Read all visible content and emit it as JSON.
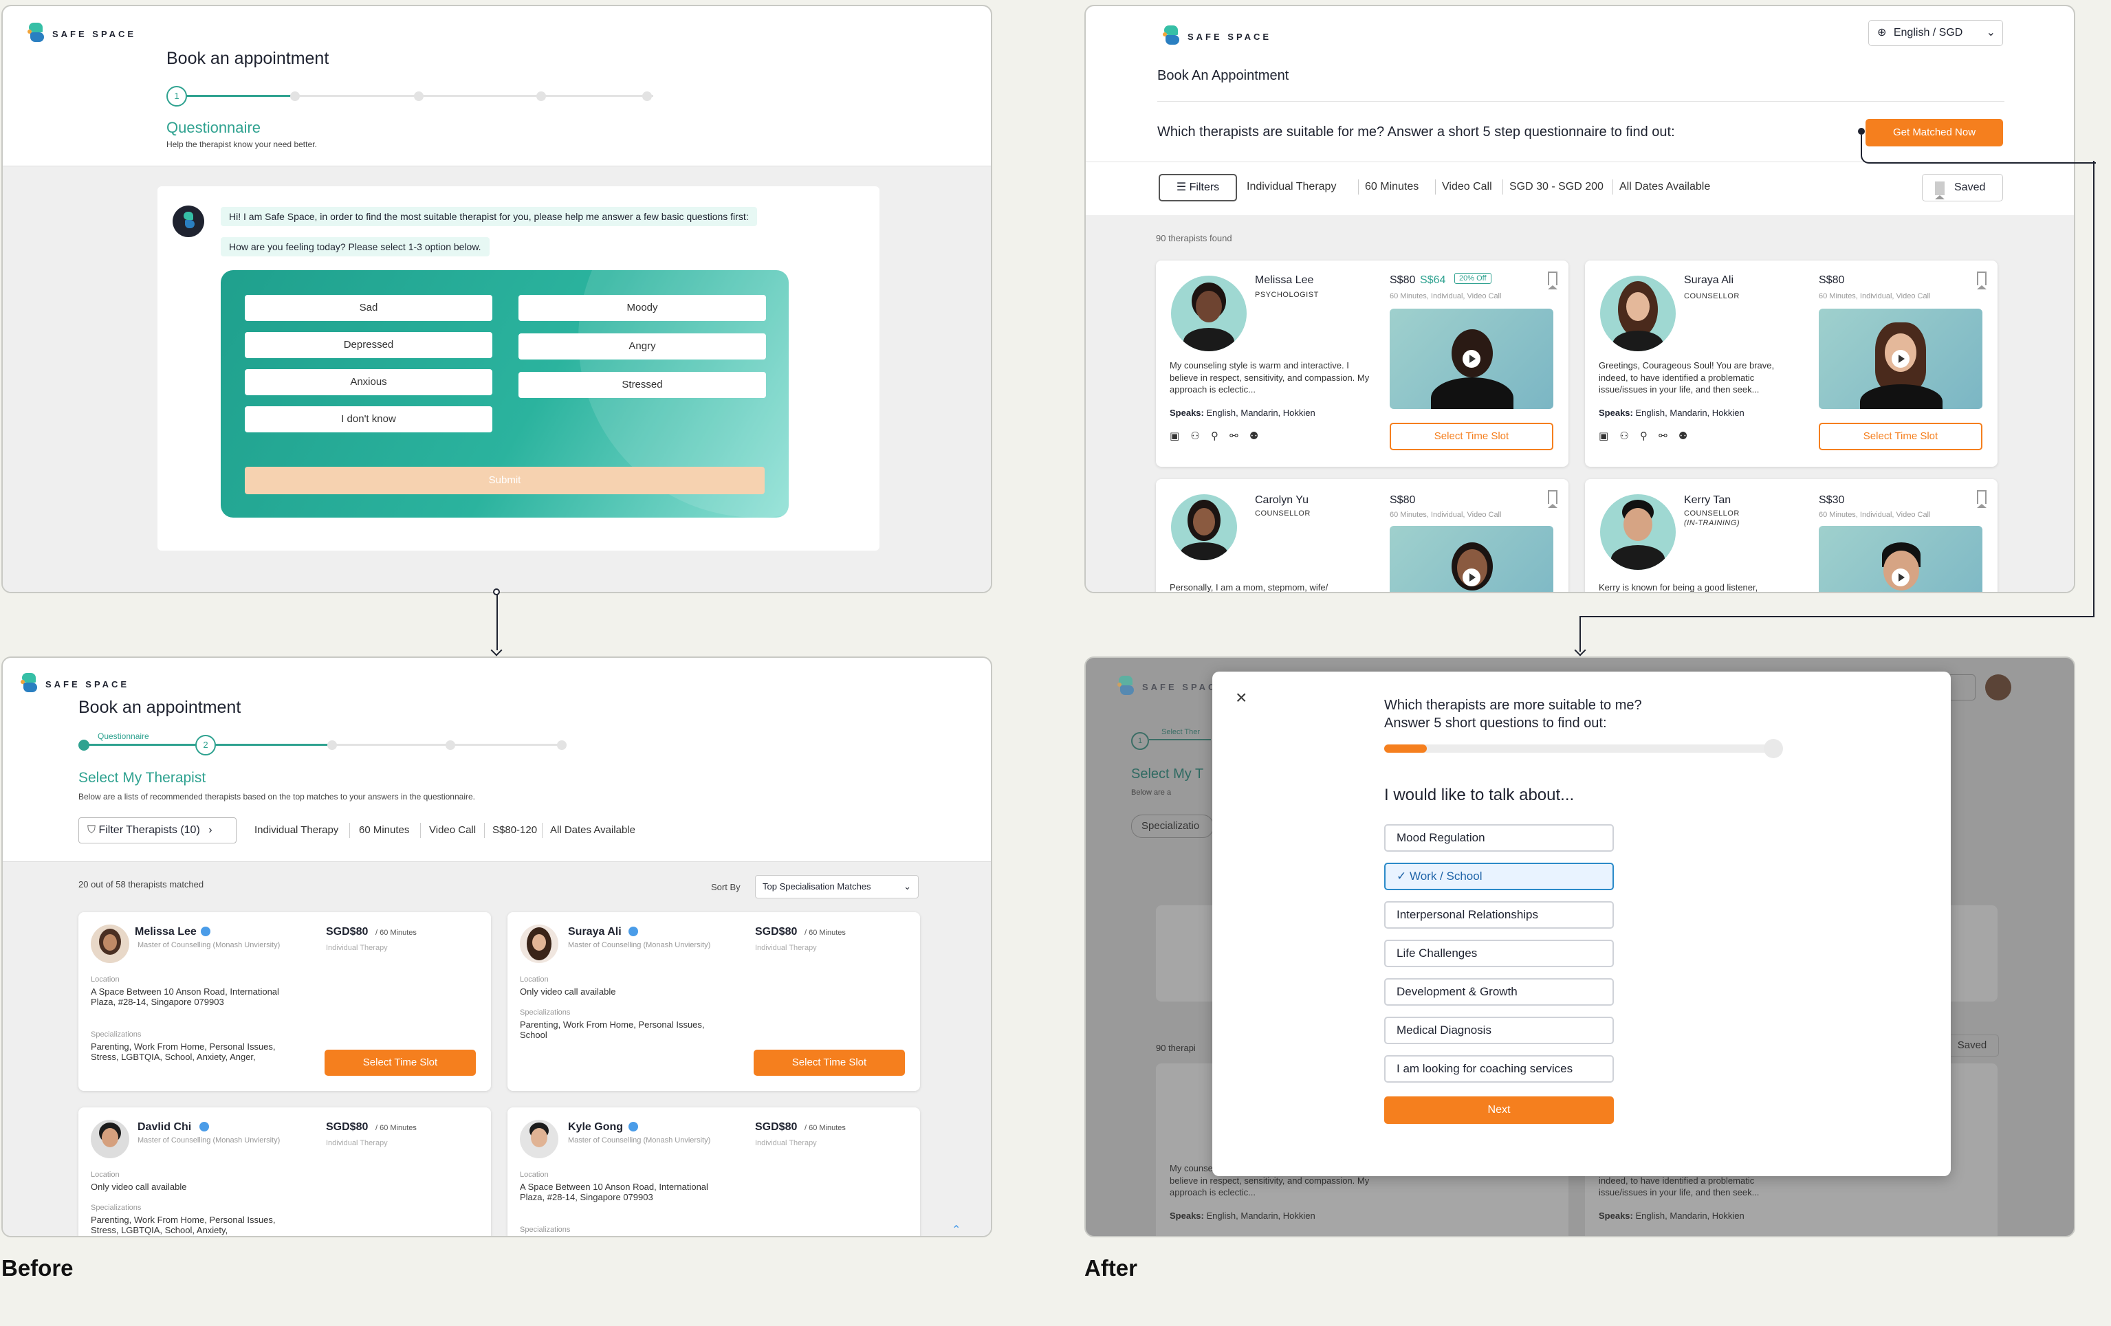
{
  "brand": {
    "logo_text": "SAFE SPACE",
    "teal": "#2fa290",
    "orange": "#f57f1e",
    "blue": "#2b8ac9"
  },
  "captions": {
    "before": "Before",
    "after": "After"
  },
  "before_q": {
    "title": "Book an appointment",
    "step_number": "1",
    "section_title": "Questionnaire",
    "section_subtitle": "Help the therapist know your need better.",
    "bot_message_1": "Hi! I am Safe Space, in order to find the most suitable therapist for you, please help me answer a few basic questions first:",
    "bot_message_2": "How are you feeling today? Please select 1-3 option below.",
    "options_left": [
      "Sad",
      "Depressed",
      "Anxious",
      "I don't know"
    ],
    "options_right": [
      "Moody",
      "Angry",
      "Stressed"
    ],
    "submit_label": "Submit"
  },
  "before_list": {
    "title": "Book an appointment",
    "step1_label": "Questionnaire",
    "step_number": "2",
    "section_title": "Select My Therapist",
    "section_subtitle": "Below are a lists of recommended therapists based on the top matches to your answers in the questionnaire.",
    "filter_button": "Filter Therapists (10)",
    "filters": [
      "Individual Therapy",
      "60 Minutes",
      "Video Call",
      "S$80-120",
      "All Dates Available"
    ],
    "count_text": "20 out of 58 therapists matched",
    "sort_label": "Sort By",
    "sort_value": "Top Specialisation Matches",
    "location_label": "Location",
    "specializations_label": "Specializations",
    "cards": [
      {
        "name": "Melissa Lee",
        "degree": "Master of Counselling (Monash Unviersity)",
        "price": "SGD$80",
        "unit": "/ 60 Minutes",
        "type": "Individual Therapy",
        "location": "A Space Between 10 Anson Road, International Plaza, #28-14, Singapore 079903",
        "specializations": "Parenting, Work From Home, Personal Issues, Stress, LGBTQIA, School, Anxiety, Anger,",
        "button": "Select Time Slot"
      },
      {
        "name": "Suraya Ali",
        "degree": "Master of Counselling (Monash Unviersity)",
        "price": "SGD$80",
        "unit": "/ 60 Minutes",
        "type": "Individual Therapy",
        "location": "Only video call available",
        "specializations": "Parenting, Work From Home, Personal Issues, School",
        "button": "Select Time Slot"
      },
      {
        "name": "Davlid Chi",
        "degree": "Master of Counselling (Monash Unviersity)",
        "price": "SGD$80",
        "unit": "/ 60 Minutes",
        "type": "Individual Therapy",
        "location": "Only video call available",
        "specializations": "Parenting, Work From Home, Personal Issues, Stress, LGBTQIA, School, Anxiety,"
      },
      {
        "name": "Kyle Gong",
        "degree": "Master of Counselling (Monash Unviersity)",
        "price": "SGD$80",
        "unit": "/ 60 Minutes",
        "type": "Individual Therapy",
        "location": "A Space Between 10 Anson Road, International Plaza, #28-14, Singapore 079903"
      }
    ]
  },
  "after_list": {
    "language": "English / SGD",
    "title": "Book An Appointment",
    "prompt": "Which therapists are suitable for me? Answer a short 5 step questionnaire to find out:",
    "cta": "Get Matched Now",
    "filters_button": "Filters",
    "filters": [
      "Individual Therapy",
      "60 Minutes",
      "Video Call",
      "SGD 30 - SGD 200",
      "All Dates Available"
    ],
    "saved_button": "Saved",
    "count_text": "90 therapists found",
    "speaks_label": "Speaks:",
    "cards": [
      {
        "name": "Melissa Lee",
        "role": "PSYCHOLOGIST",
        "price": "S$80",
        "discount_price": "S$64",
        "discount_badge": "20% Off",
        "details": "60 Minutes, Individual, Video Call",
        "bio": "My counseling style is warm and interactive. I believe in respect, sensitivity, and compassion. My approach is eclectic...",
        "speaks": "English, Mandarin, Hokkien",
        "button": "Select Time Slot"
      },
      {
        "name": "Suraya Ali",
        "role": "COUNSELLOR",
        "price": "S$80",
        "details": "60 Minutes, Individual, Video Call",
        "bio": "Greetings, Courageous Soul! You are brave, indeed, to have identified a problematic issue/issues in your life, and then seek...",
        "speaks": "English, Mandarin, Hokkien",
        "button": "Select Time Slot"
      },
      {
        "name": "Carolyn Yu",
        "role": "COUNSELLOR",
        "price": "S$80",
        "details": "60 Minutes, Individual, Video Call",
        "bio": "Personally, I am a mom, stepmom, wife/"
      },
      {
        "name": "Kerry Tan",
        "role": "COUNSELLOR",
        "role2": "(IN-TRAINING)",
        "price": "S$30",
        "details": "60 Minutes, Individual, Video Call",
        "bio": "Kerry is known for being a good listener,"
      }
    ]
  },
  "after_modal": {
    "background": {
      "step_label": "Select Ther",
      "step_number": "1",
      "title": "Select My T",
      "subtitle": "Below are a",
      "chip": "Specializatio",
      "count": "90 therapi",
      "saved": "Saved",
      "bio1": "My counseling style is warm and interactive. I believe in respect, sensitivity, and compassion. My approach is eclectic...",
      "speaks1": "English, Mandarin, Hokkien",
      "bio2": "Greetings, Courageous Soul! You are brave, indeed, to have identified a problematic issue/issues in your life, and then seek...",
      "speaks2": "English, Mandarin, Hokkien"
    },
    "title_line1": "Which therapists are more suitable to me?",
    "title_line2": "Answer 5 short questions to find out:",
    "progress_fraction": 0.11,
    "question": "I would like to talk about...",
    "options": [
      "Mood Regulation",
      "Work / School",
      "Interpersonal Relationships",
      "Life Challenges",
      "Development & Growth",
      "Medical Diagnosis",
      "I am looking for coaching services"
    ],
    "selected_index": 1,
    "next_label": "Next"
  }
}
